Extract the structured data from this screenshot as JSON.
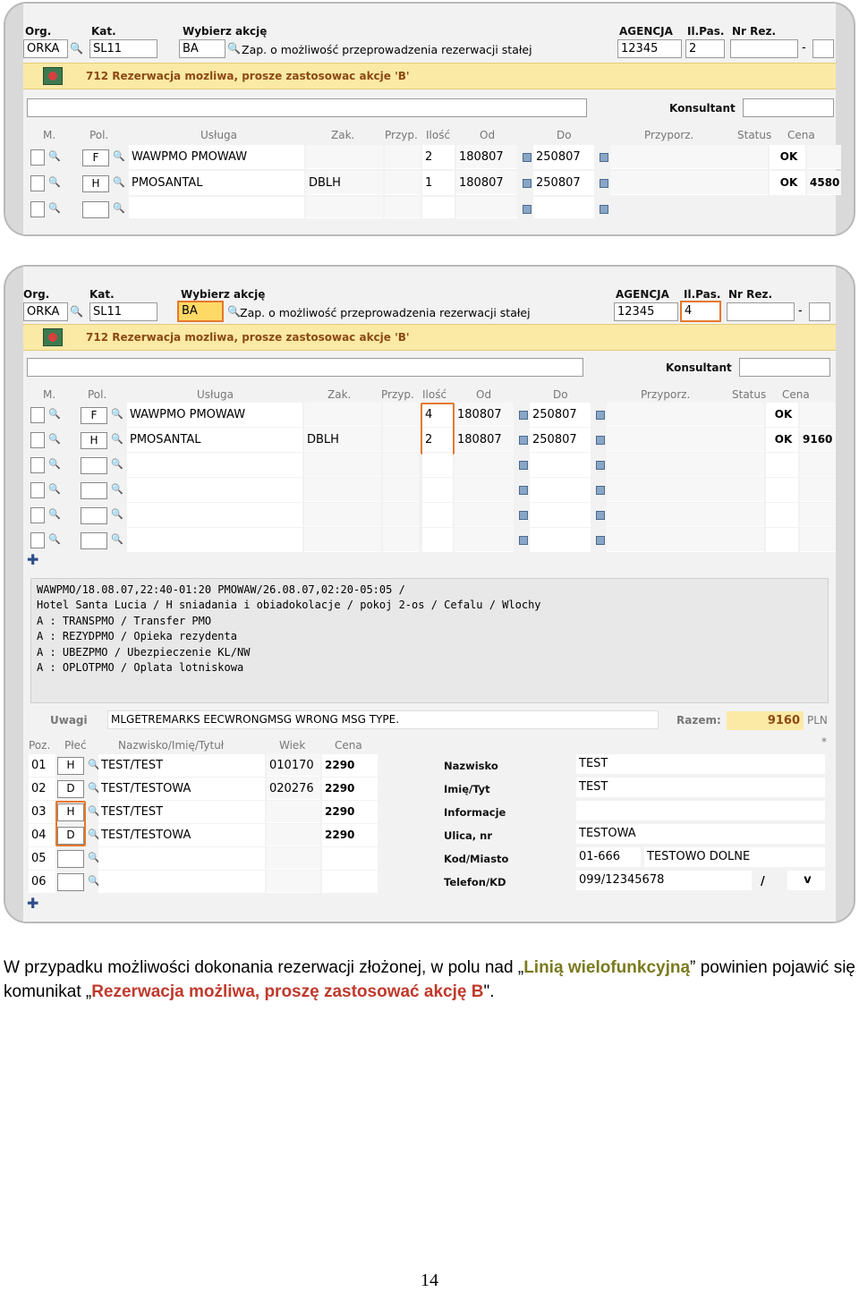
{
  "header": {
    "org_label": "Org.",
    "kat_label": "Kat.",
    "akcja_label": "Wybierz akcję",
    "agencja_label": "AGENCJA",
    "ilpas_label": "Il.Pas.",
    "nrrez_label": "Nr Rez.",
    "org_value": "ORKA",
    "kat_value": "SL11",
    "akcja_value": "BA",
    "akcja_desc": "Zap. o możliwość przeprowadzenia rezerwacji stałej",
    "agencja_value": "12345",
    "dash": "-",
    "konsultant_label": "Konsultant"
  },
  "message": "712 Rezerwacja mozliwa, prosze zastosowac akcje 'B'",
  "columns": {
    "m": "M.",
    "pol": "Pol.",
    "usluga": "Usługa",
    "zak": "Zak.",
    "przyp": "Przyp.",
    "ilosc": "Ilość",
    "od": "Od",
    "do": "Do",
    "przyporz": "Przyporz.",
    "status": "Status",
    "cena": "Cena"
  },
  "shot1": {
    "ilpas": "2",
    "rows": [
      {
        "pol": "F",
        "usluga": "WAWPMO PMOWAW",
        "zak": "",
        "ilosc": "2",
        "od": "180807",
        "do": "250807",
        "status": "OK",
        "cena": ""
      },
      {
        "pol": "H",
        "usluga": "PMOSANTAL",
        "zak": "DBLH",
        "ilosc": "1",
        "od": "180807",
        "do": "250807",
        "status": "OK",
        "cena": "4580"
      }
    ]
  },
  "shot2": {
    "ilpas": "4",
    "rows": [
      {
        "pol": "F",
        "usluga": "WAWPMO PMOWAW",
        "zak": "",
        "ilosc": "4",
        "od": "180807",
        "do": "250807",
        "status": "OK",
        "cena": ""
      },
      {
        "pol": "H",
        "usluga": "PMOSANTAL",
        "zak": "DBLH",
        "ilosc": "2",
        "od": "180807",
        "do": "250807",
        "status": "OK",
        "cena": "9160"
      }
    ],
    "pnr_lines": [
      "WAWPMO/18.08.07,22:40-01:20 PMOWAW/26.08.07,02:20-05:05 /",
      "Hotel Santa Lucia / H sniadania i obiadokolacje / pokoj 2-os / Cefalu / Wlochy",
      "A : TRANSPMO / Transfer PMO",
      "A : REZYDPMO / Opieka rezydenta",
      "A : UBEZPMO / Ubezpieczenie KL/NW",
      "A : OPLOTPMO / Oplata lotniskowa"
    ],
    "uwagi_label": "Uwagi",
    "uwagi_value": "MLGETREMARKS EECWRONGMSG  WRONG MSG TYPE.",
    "razem_label": "Razem:",
    "razem_value": "9160",
    "currency": "PLN",
    "pax_columns": {
      "poz": "Poz.",
      "plec": "Płeć",
      "nazwisko": "Nazwisko/Imię/Tytuł",
      "wiek": "Wiek",
      "cena": "Cena",
      "star": "*"
    },
    "pax": [
      {
        "poz": "01",
        "plec": "H",
        "name": "TEST/TEST",
        "wiek": "010170",
        "cena": "2290"
      },
      {
        "poz": "02",
        "plec": "D",
        "name": "TEST/TESTOWA",
        "wiek": "020276",
        "cena": "2290"
      },
      {
        "poz": "03",
        "plec": "H",
        "name": "TEST/TEST",
        "wiek": "",
        "cena": "2290"
      },
      {
        "poz": "04",
        "plec": "D",
        "name": "TEST/TESTOWA",
        "wiek": "",
        "cena": "2290"
      },
      {
        "poz": "05",
        "plec": "",
        "name": "",
        "wiek": "",
        "cena": ""
      },
      {
        "poz": "06",
        "plec": "",
        "name": "",
        "wiek": "",
        "cena": ""
      }
    ],
    "details": [
      {
        "label": "Nazwisko",
        "value": "TEST",
        "value2": ""
      },
      {
        "label": "Imię/Tyt",
        "value": "TEST",
        "value2": ""
      },
      {
        "label": "Informacje",
        "value": "",
        "value2": ""
      },
      {
        "label": "Ulica, nr",
        "value": "TESTOWA",
        "value2": ""
      },
      {
        "label": "Kod/Miasto",
        "value": "01-666",
        "value2": "TESTOWO DOLNE"
      },
      {
        "label": "Telefon/KD",
        "value": "099/12345678",
        "value2": ""
      }
    ],
    "phone_slash": "/",
    "phone_v": "v"
  },
  "caption": {
    "part1": "W przypadku możliwości dokonania rezerwacji złożonej, w polu nad „",
    "highlight1": "Linią wielofunkcyjną",
    "part2": "” powinien pojawić się komunikat „",
    "highlight2": "Rezerwacja możliwa, proszę zastosować akcję B",
    "part3": "\"."
  },
  "page_number": "14"
}
